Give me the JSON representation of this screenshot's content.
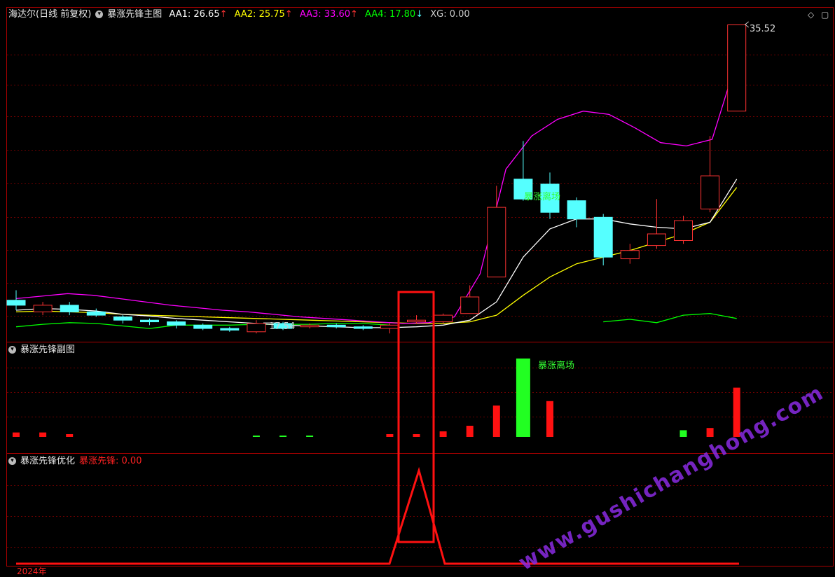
{
  "main_header": {
    "stock": "海达尔(日线 前复权)",
    "indicator": "暴涨先锋主图",
    "aa1": "AA1: 26.65",
    "aa2": "AA2: 25.75",
    "aa3": "AA3: 33.60",
    "aa4": "AA4: 17.80",
    "xg": "XG: 0.00",
    "arrow_up": "↑",
    "arrow_down": "↓"
  },
  "colors": {
    "aa1": "#ffffff",
    "aa2": "#ffff00",
    "aa3": "#ff00ff",
    "aa4": "#00ff00",
    "up_candle": "#ff3333",
    "down_candle": "#55ffff",
    "grid": "#6a0000",
    "border": "#aa0000"
  },
  "sub_header": {
    "title": "暴涨先锋副图"
  },
  "third_header": {
    "title": "暴涨先锋优化",
    "value": "暴涨先锋: 0.00"
  },
  "labels": {
    "high_price": "35.52",
    "low_price": "17.54",
    "exit_main": "暴涨离场",
    "exit_sub": "暴涨离场",
    "year": "2024年",
    "watermark": "www.gushichanghong.com"
  },
  "icons": {
    "diamond": "diamond-icon",
    "window": "window-icon",
    "dropdown": "dropdown-circle-icon"
  },
  "chart_data": {
    "type": "candlestick",
    "price_range": [
      17.54,
      35.52
    ],
    "candles": [
      {
        "o": 18.9,
        "c": 18.6,
        "h": 19.5,
        "l": 18.3
      },
      {
        "o": 18.2,
        "c": 18.6,
        "h": 18.8,
        "l": 18.0
      },
      {
        "o": 18.6,
        "c": 18.2,
        "h": 18.8,
        "l": 18.0
      },
      {
        "o": 18.2,
        "c": 18.0,
        "h": 18.4,
        "l": 17.9
      },
      {
        "o": 17.9,
        "c": 17.7,
        "h": 18.0,
        "l": 17.5
      },
      {
        "o": 17.7,
        "c": 17.6,
        "h": 17.8,
        "l": 17.4
      },
      {
        "o": 17.6,
        "c": 17.4,
        "h": 17.7,
        "l": 17.2
      },
      {
        "o": 17.4,
        "c": 17.2,
        "h": 17.5,
        "l": 17.1
      },
      {
        "o": 17.2,
        "c": 17.1,
        "h": 17.3,
        "l": 17.0
      },
      {
        "o": 17.0,
        "c": 17.5,
        "h": 17.7,
        "l": 16.9
      },
      {
        "o": 17.5,
        "c": 17.2,
        "h": 17.6,
        "l": 17.1
      },
      {
        "o": 17.3,
        "c": 17.4,
        "h": 17.5,
        "l": 17.2
      },
      {
        "o": 17.4,
        "c": 17.3,
        "h": 17.5,
        "l": 17.2
      },
      {
        "o": 17.3,
        "c": 17.2,
        "h": 17.4,
        "l": 17.1
      },
      {
        "o": 17.2,
        "c": 17.4,
        "h": 17.5,
        "l": 16.9
      },
      {
        "o": 17.6,
        "c": 17.7,
        "h": 18.0,
        "l": 17.5
      },
      {
        "o": 17.6,
        "c": 18.0,
        "h": 18.1,
        "l": 17.5
      },
      {
        "o": 18.1,
        "c": 19.1,
        "h": 19.8,
        "l": 18.1
      },
      {
        "o": 20.3,
        "c": 24.5,
        "h": 25.8,
        "l": 21.6
      },
      {
        "o": 26.2,
        "c": 25.0,
        "h": 28.5,
        "l": 24.9
      },
      {
        "o": 25.9,
        "c": 24.2,
        "h": 26.6,
        "l": 23.8
      },
      {
        "o": 24.9,
        "c": 23.8,
        "h": 25.1,
        "l": 23.3
      },
      {
        "o": 23.9,
        "c": 21.5,
        "h": 24.1,
        "l": 21.0
      },
      {
        "o": 21.4,
        "c": 21.9,
        "h": 22.3,
        "l": 21.1
      },
      {
        "o": 22.2,
        "c": 22.9,
        "h": 25.0,
        "l": 22.0
      },
      {
        "o": 22.5,
        "c": 23.7,
        "h": 24.0,
        "l": 22.3
      },
      {
        "o": 24.4,
        "c": 26.4,
        "h": 28.8,
        "l": 24.2
      },
      {
        "o": 30.3,
        "c": 35.5,
        "h": 35.5,
        "l": 30.3
      }
    ],
    "aa1": [
      18.3,
      18.4,
      18.35,
      18.25,
      18.05,
      17.95,
      17.8,
      17.7,
      17.6,
      17.5,
      17.4,
      17.35,
      17.3,
      17.25,
      17.25,
      17.3,
      17.4,
      17.7,
      18.8,
      21.5,
      23.2,
      23.8,
      23.8,
      23.5,
      23.3,
      23.2,
      23.6,
      26.2
    ],
    "aa2": [
      18.2,
      18.25,
      18.2,
      18.15,
      18.05,
      18.0,
      17.95,
      17.9,
      17.85,
      17.8,
      17.75,
      17.7,
      17.65,
      17.6,
      17.55,
      17.5,
      17.5,
      17.6,
      18.0,
      19.2,
      20.3,
      21.1,
      21.5,
      21.9,
      22.4,
      22.9,
      23.6,
      25.7
    ],
    "aa3": [
      19.0,
      19.15,
      19.3,
      19.2,
      19.0,
      18.8,
      18.6,
      18.45,
      18.3,
      18.2,
      18.05,
      17.9,
      17.8,
      17.7,
      17.6,
      17.5,
      17.55,
      17.9,
      20.5,
      26.8,
      28.8,
      29.8,
      30.3,
      30.1,
      29.3,
      28.4,
      28.2,
      28.6,
      33.6
    ],
    "aa4": [
      17.3,
      17.45,
      17.55,
      17.5,
      17.35,
      17.2,
      17.4,
      17.4,
      17.4,
      17.45,
      17.45,
      17.45,
      17.5,
      17.5,
      17.4,
      null,
      null,
      null,
      null,
      null,
      null,
      null,
      17.6,
      17.75,
      17.55,
      18.0,
      18.1,
      17.8
    ],
    "sub_bars": [
      0.4,
      0.4,
      0.2,
      null,
      null,
      null,
      null,
      null,
      null,
      -0.1,
      -0.1,
      -0.05,
      null,
      null,
      0.15,
      0.2,
      0.5,
      1.0,
      2.8,
      -7.0,
      3.2,
      null,
      null,
      null,
      null,
      -0.6,
      0.8,
      4.4
    ]
  }
}
